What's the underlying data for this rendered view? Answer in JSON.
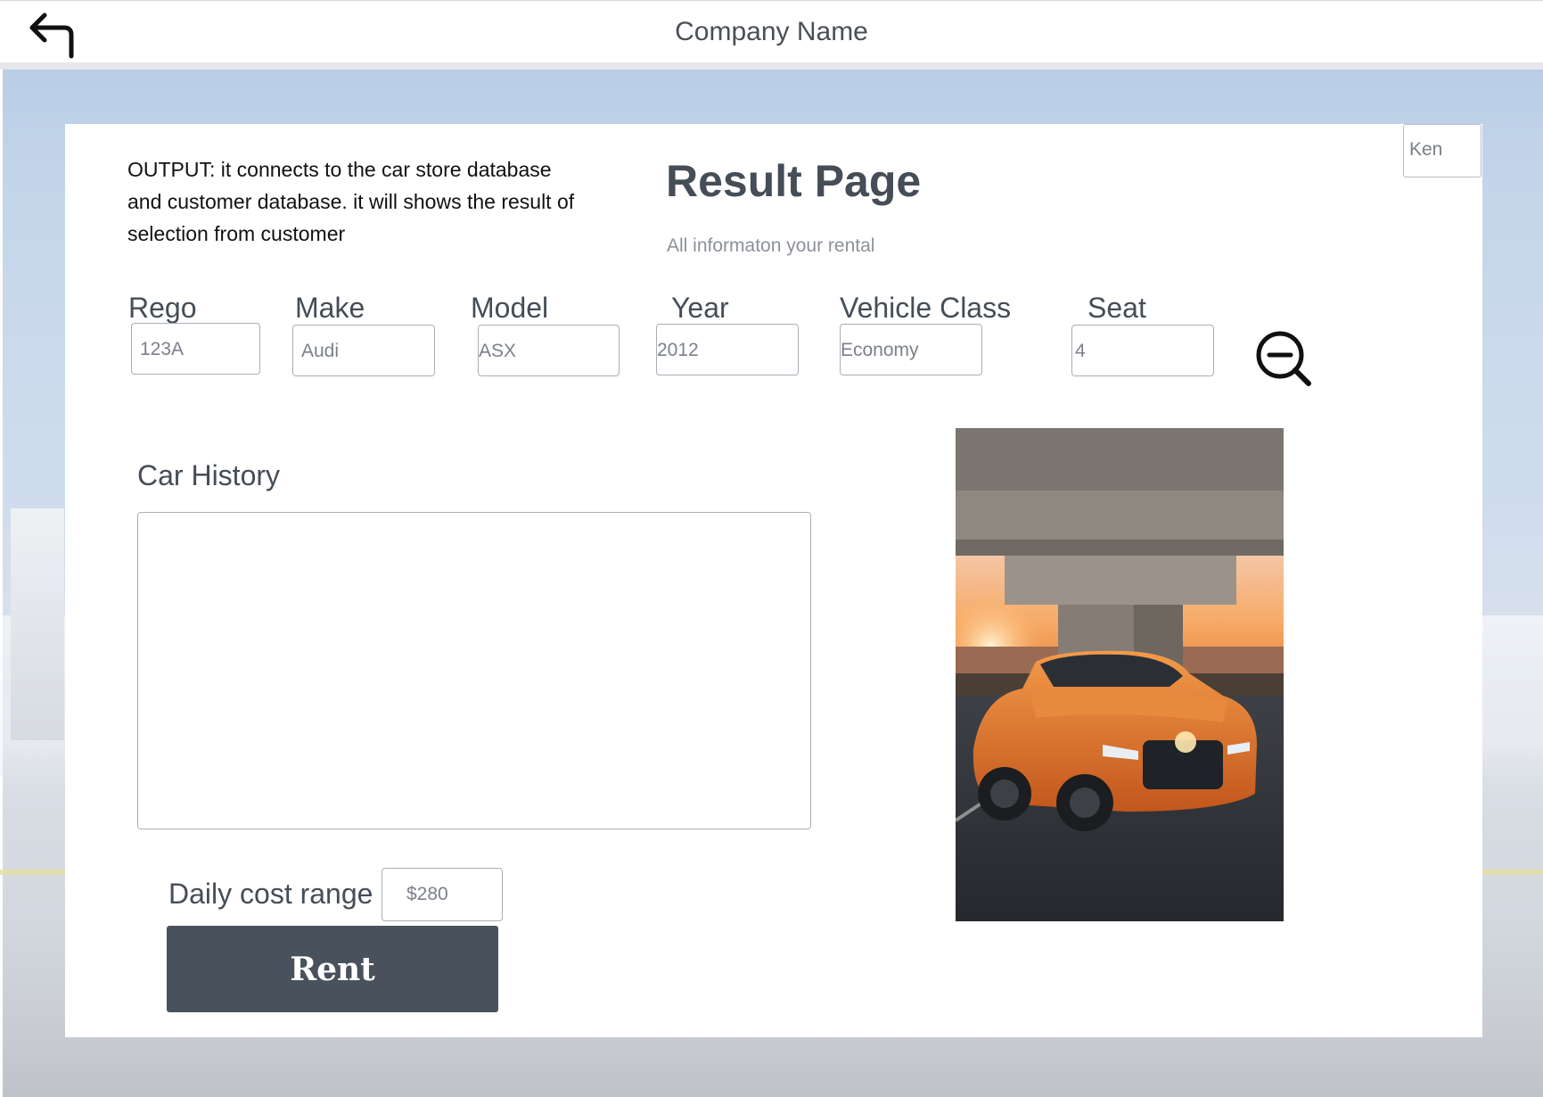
{
  "header": {
    "company_name": "Company Name",
    "back_icon": "back-arrow-icon"
  },
  "user": {
    "name": "Ken"
  },
  "page": {
    "output_note": "OUTPUT: it connects to the car store database and customer database. it will shows the result of selection from customer",
    "title": "Result Page",
    "subtitle": "All informaton your rental"
  },
  "fields": {
    "rego": {
      "label": "Rego",
      "value": "123A"
    },
    "make": {
      "label": "Make",
      "value": "Audi"
    },
    "model": {
      "label": "Model",
      "value": "ASX"
    },
    "year": {
      "label": "Year",
      "value": "2012"
    },
    "vehicle_class": {
      "label": "Vehicle Class",
      "value": "Economy"
    },
    "seat": {
      "label": "Seat",
      "value": "4"
    }
  },
  "zoom": {
    "icon": "zoom-out-icon"
  },
  "history": {
    "label": "Car History",
    "value": ""
  },
  "cost": {
    "label": "Daily cost range",
    "value": "$280"
  },
  "actions": {
    "rent_label": "Rent"
  },
  "car_image": {
    "description": "orange coupe under concrete bridge at sunset",
    "accent_color": "#e8782a"
  },
  "colors": {
    "primary_text": "#454d57",
    "button_bg": "#49515c",
    "muted_text": "#8b9099"
  }
}
